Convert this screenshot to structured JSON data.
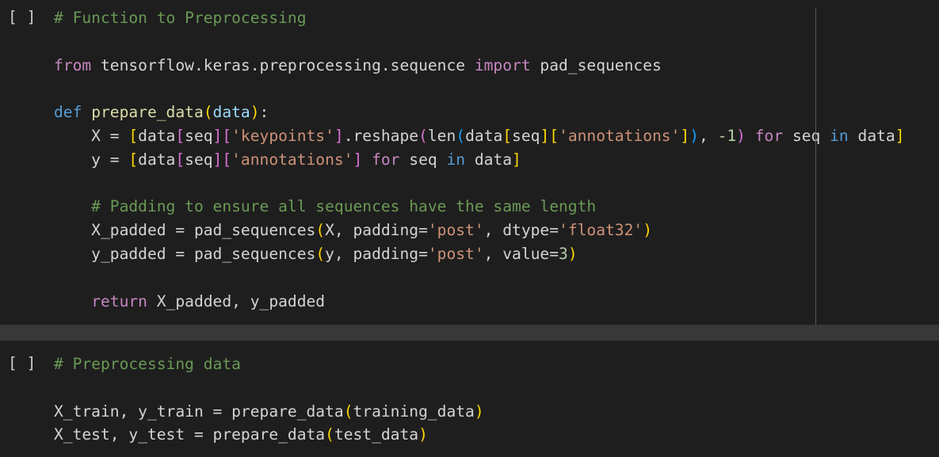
{
  "colors": {
    "background": "#1e1e1e",
    "separator": "#383838",
    "comment": "#6a9955",
    "keyword": "#c586c0",
    "def_keyword": "#569cd6",
    "function": "#dcdcaa",
    "string": "#ce9178",
    "number": "#b5cea8",
    "text": "#d4d4d4",
    "bracket_level1": "#ffd700",
    "bracket_level2": "#da70d6",
    "bracket_level3": "#179fff"
  },
  "cells": [
    {
      "run_indicator": "[ ]",
      "lines": [
        [
          {
            "t": "# Function to Preprocessing",
            "c": "comment"
          }
        ],
        [],
        [
          {
            "t": "from",
            "c": "kw"
          },
          {
            "t": " tensorflow.keras.preprocessing.sequence ",
            "c": "text"
          },
          {
            "t": "import",
            "c": "kw"
          },
          {
            "t": " pad_sequences",
            "c": "text"
          }
        ],
        [],
        [
          {
            "t": "def",
            "c": "def"
          },
          {
            "t": " ",
            "c": "text"
          },
          {
            "t": "prepare_data",
            "c": "fn"
          },
          {
            "t": "(",
            "c": "b1"
          },
          {
            "t": "data",
            "c": "var"
          },
          {
            "t": ")",
            "c": "b1"
          },
          {
            "t": ":",
            "c": "text"
          }
        ],
        [
          {
            "t": "    X = ",
            "c": "text"
          },
          {
            "t": "[",
            "c": "b1"
          },
          {
            "t": "data",
            "c": "text"
          },
          {
            "t": "[",
            "c": "b2"
          },
          {
            "t": "seq",
            "c": "text"
          },
          {
            "t": "][",
            "c": "b2"
          },
          {
            "t": "'keypoints'",
            "c": "str"
          },
          {
            "t": "]",
            "c": "b2"
          },
          {
            "t": ".reshape",
            "c": "text"
          },
          {
            "t": "(",
            "c": "b2"
          },
          {
            "t": "len",
            "c": "text"
          },
          {
            "t": "(",
            "c": "b3"
          },
          {
            "t": "data",
            "c": "text"
          },
          {
            "t": "[",
            "c": "b1"
          },
          {
            "t": "seq",
            "c": "text"
          },
          {
            "t": "][",
            "c": "b1"
          },
          {
            "t": "'annotations'",
            "c": "str"
          },
          {
            "t": "]",
            "c": "b1"
          },
          {
            "t": ")",
            "c": "b3"
          },
          {
            "t": ", ",
            "c": "text"
          },
          {
            "t": "-1",
            "c": "num"
          },
          {
            "t": ")",
            "c": "b2"
          },
          {
            "t": " ",
            "c": "text"
          },
          {
            "t": "for",
            "c": "kw"
          },
          {
            "t": " seq ",
            "c": "text"
          },
          {
            "t": "in",
            "c": "def"
          },
          {
            "t": " data",
            "c": "text"
          },
          {
            "t": "]",
            "c": "b1"
          }
        ],
        [
          {
            "t": "    y = ",
            "c": "text"
          },
          {
            "t": "[",
            "c": "b1"
          },
          {
            "t": "data",
            "c": "text"
          },
          {
            "t": "[",
            "c": "b2"
          },
          {
            "t": "seq",
            "c": "text"
          },
          {
            "t": "][",
            "c": "b2"
          },
          {
            "t": "'annotations'",
            "c": "str"
          },
          {
            "t": "]",
            "c": "b2"
          },
          {
            "t": " ",
            "c": "text"
          },
          {
            "t": "for",
            "c": "kw"
          },
          {
            "t": " seq ",
            "c": "text"
          },
          {
            "t": "in",
            "c": "def"
          },
          {
            "t": " data",
            "c": "text"
          },
          {
            "t": "]",
            "c": "b1"
          }
        ],
        [],
        [
          {
            "t": "    # Padding to ensure all sequences have the same length",
            "c": "comment"
          }
        ],
        [
          {
            "t": "    X_padded = pad_sequences",
            "c": "text"
          },
          {
            "t": "(",
            "c": "b1"
          },
          {
            "t": "X, padding=",
            "c": "text"
          },
          {
            "t": "'post'",
            "c": "str"
          },
          {
            "t": ", dtype=",
            "c": "text"
          },
          {
            "t": "'float32'",
            "c": "str"
          },
          {
            "t": ")",
            "c": "b1"
          }
        ],
        [
          {
            "t": "    y_padded = pad_sequences",
            "c": "text"
          },
          {
            "t": "(",
            "c": "b1"
          },
          {
            "t": "y, padding=",
            "c": "text"
          },
          {
            "t": "'post'",
            "c": "str"
          },
          {
            "t": ", value=",
            "c": "text"
          },
          {
            "t": "3",
            "c": "num"
          },
          {
            "t": ")",
            "c": "b1"
          }
        ],
        [],
        [
          {
            "t": "    ",
            "c": "text"
          },
          {
            "t": "return",
            "c": "kw"
          },
          {
            "t": " X_padded, y_padded",
            "c": "text"
          }
        ]
      ]
    },
    {
      "run_indicator": "[ ]",
      "lines": [
        [
          {
            "t": "# Preprocessing data",
            "c": "comment"
          }
        ],
        [],
        [
          {
            "t": "X_train, y_train = prepare_data",
            "c": "text"
          },
          {
            "t": "(",
            "c": "b1"
          },
          {
            "t": "training_data",
            "c": "text"
          },
          {
            "t": ")",
            "c": "b1"
          }
        ],
        [
          {
            "t": "X_test, y_test = prepare_data",
            "c": "text"
          },
          {
            "t": "(",
            "c": "b1"
          },
          {
            "t": "test_data",
            "c": "text"
          },
          {
            "t": ")",
            "c": "b1"
          }
        ]
      ]
    }
  ]
}
